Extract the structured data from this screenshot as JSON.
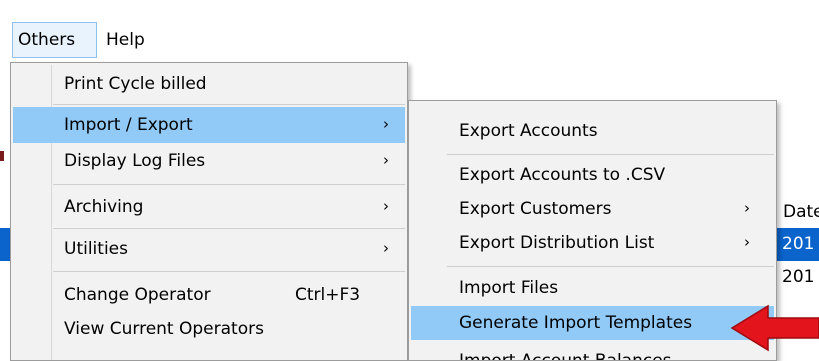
{
  "menubar": {
    "items": [
      {
        "label": "Others"
      },
      {
        "label": "Help"
      }
    ]
  },
  "background": {
    "column_header": "Date",
    "row1": "201",
    "row2": "201"
  },
  "others_menu": {
    "items": [
      {
        "label": "Print Cycle billed"
      },
      {
        "label": "Import / Export",
        "arrow": "›"
      },
      {
        "label": "Display Log Files",
        "arrow": "›"
      },
      {
        "label": "Archiving",
        "arrow": "›"
      },
      {
        "label": "Utilities",
        "arrow": "›"
      },
      {
        "label": "Change Operator",
        "shortcut": "Ctrl+F3"
      },
      {
        "label": "View Current Operators"
      }
    ]
  },
  "import_export_menu": {
    "items": [
      {
        "label": "Export Accounts"
      },
      {
        "label": "Export Accounts to .CSV"
      },
      {
        "label": "Export Customers",
        "arrow": "›"
      },
      {
        "label": "Export Distribution List",
        "arrow": "›"
      },
      {
        "label": "Import Files"
      },
      {
        "label": "Generate Import Templates"
      },
      {
        "label": "Import Account Balances"
      }
    ]
  },
  "colors": {
    "highlight": "#91c9f7",
    "selection_blue": "#0a64cc",
    "annotation_red": "#e3141b"
  }
}
